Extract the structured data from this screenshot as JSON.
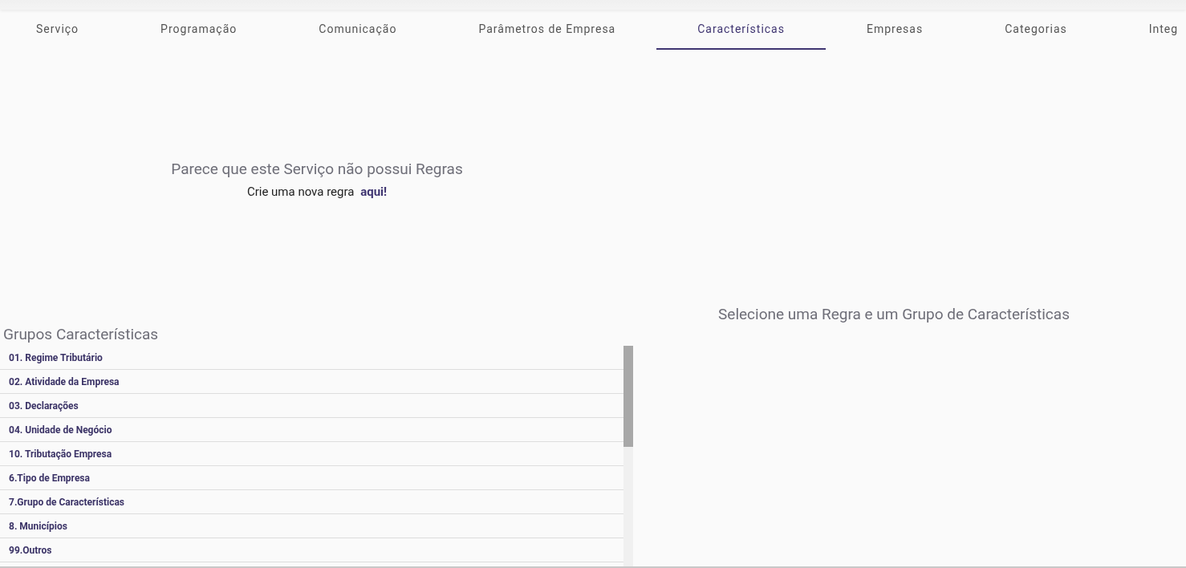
{
  "tabs": [
    {
      "label": "Serviço",
      "selected": false
    },
    {
      "label": "Programação",
      "selected": false
    },
    {
      "label": "Comunicação",
      "selected": false
    },
    {
      "label": "Parâmetros de Empresa",
      "selected": false
    },
    {
      "label": "Características",
      "selected": true
    },
    {
      "label": "Empresas",
      "selected": false
    },
    {
      "label": "Categorias",
      "selected": false
    },
    {
      "label": "Integ",
      "selected": false
    }
  ],
  "empty_rules": {
    "title": "Parece que este Serviço não possui Regras",
    "text": "Crie uma nova regra",
    "link": "aqui!"
  },
  "groups": {
    "title": "Grupos Características",
    "items": [
      "01. Regime Tributário",
      "02. Atividade da Empresa",
      "03. Declarações",
      "04. Unidade de Negócio",
      "10. Tributação Empresa",
      "6.Tipo de Empresa",
      "7.Grupo de Características",
      "8. Municípios",
      "99.Outros"
    ]
  },
  "detail": {
    "message": "Selecione uma Regra e um Grupo de Características"
  }
}
